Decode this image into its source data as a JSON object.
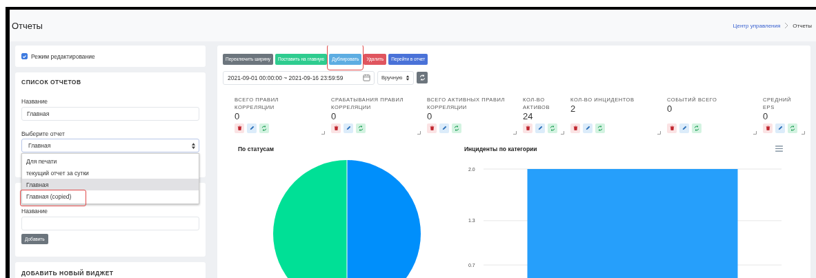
{
  "header": {
    "title": "Отчеты",
    "breadcrumb": [
      {
        "label": "Центр управления",
        "link": true
      },
      {
        "label": "Отчеты",
        "link": false
      }
    ]
  },
  "edit_mode": {
    "label": "Режим редактирование",
    "checked": true
  },
  "reports_card": {
    "title": "СПИСОК ОТЧЕТОВ",
    "name_label": "Название",
    "name_value": "Главная",
    "select_label": "Выберите отчет",
    "select_value": "Главная",
    "options": [
      {
        "label": "Для печати",
        "selected": false,
        "annotated": false
      },
      {
        "label": "текущий отчет за сутки",
        "selected": false,
        "annotated": false
      },
      {
        "label": "Главная",
        "selected": true,
        "annotated": false
      },
      {
        "label": "Главная (copied)",
        "selected": false,
        "annotated": true
      }
    ]
  },
  "add_card": {
    "name_label": "Название",
    "button": "Добавить"
  },
  "widget_card": {
    "title": "ДОБАВИТЬ НОВЫЙ ВИДЖЕТ"
  },
  "toolbar": [
    {
      "label": "Переключить ширину",
      "kind": "secondary",
      "annotated": false
    },
    {
      "label": "Поставить на главную",
      "kind": "success",
      "annotated": false
    },
    {
      "label": "Дублировать",
      "kind": "info",
      "annotated": true
    },
    {
      "label": "Удалить",
      "kind": "danger",
      "annotated": false
    },
    {
      "label": "Перейти в отчет",
      "kind": "primary",
      "annotated": false
    }
  ],
  "date_range": {
    "value": "2021-09-01 00:00:00 ~ 2021-09-16 23:59:59"
  },
  "refresh_mode": {
    "value": "Вручную"
  },
  "stats": [
    {
      "label": "ВСЕГО ПРАВИЛ КОРРЕЛЯЦИИ",
      "value": "0",
      "kind": "wide"
    },
    {
      "label": "СРАБАТЫВАНИЯ ПРАВИЛ КОРРЕЛЯЦИИ",
      "value": "0",
      "kind": "wide"
    },
    {
      "label": "ВСЕГО АКТИВНЫХ ПРАВИЛ КОРРЕЛЯЦИИ",
      "value": "0",
      "kind": "wide"
    },
    {
      "label": "КОЛ-ВО АКТИВОВ",
      "value": "24",
      "kind": "narrow"
    },
    {
      "label": "КОЛ-ВО ИНЦИДЕНТОВ",
      "value": "2",
      "kind": "wide"
    },
    {
      "label": "СОБЫТИЙ ВСЕГО",
      "value": "0",
      "kind": "wide"
    },
    {
      "label": "СРЕДНИЙ EPS",
      "value": "0",
      "kind": "narrow"
    }
  ],
  "charts": [
    {
      "kind": "pie",
      "title": "По статусам"
    },
    {
      "kind": "bar",
      "title": "Инциденты по категории",
      "chart_data": {
        "type": "bar",
        "values": [
          2.0
        ],
        "ylim": [
          0,
          2.0
        ],
        "yticks": [
          {
            "value": 0.7,
            "label": "0.7"
          },
          {
            "value": 1.3,
            "label": "1.3"
          },
          {
            "value": 2.0,
            "label": "2.0"
          }
        ]
      }
    }
  ]
}
